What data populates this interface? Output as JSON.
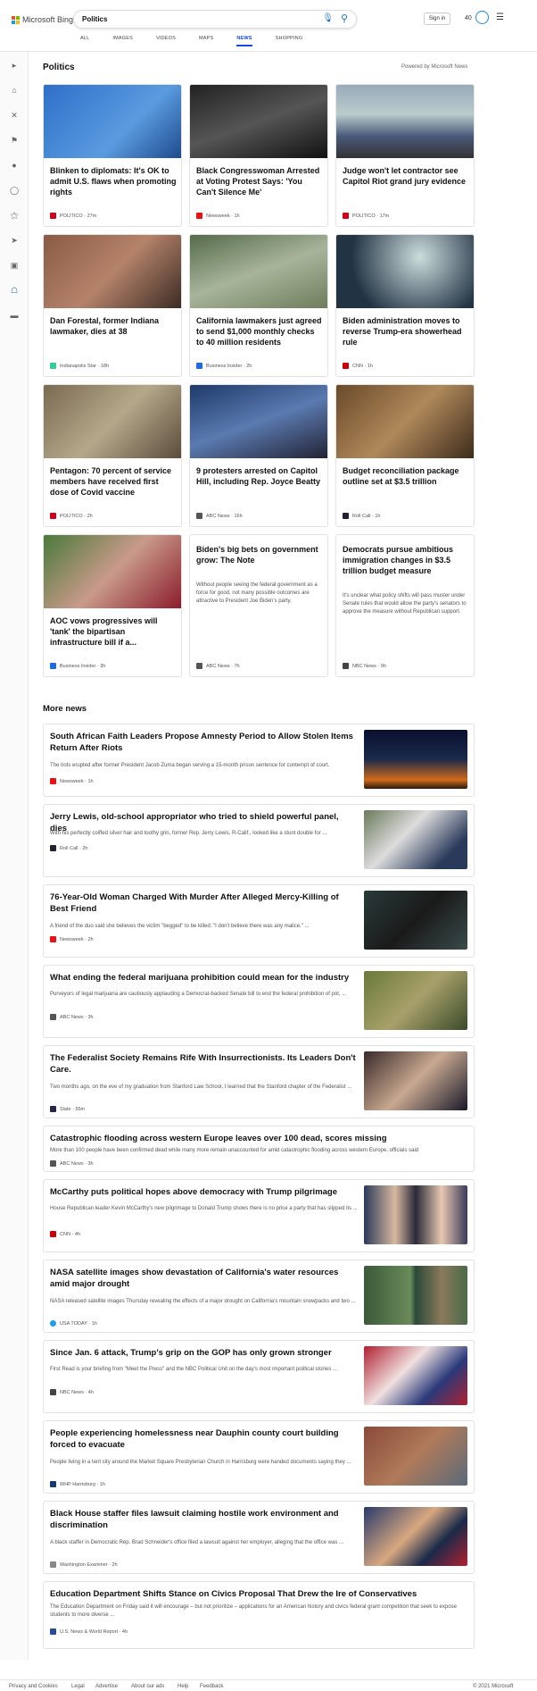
{
  "header": {
    "logo_text": "Microsoft Bing",
    "search_value": "Politics",
    "signin_label": "Sign in",
    "rewards_count": "40"
  },
  "tabs": [
    "ALL",
    "IMAGES",
    "VIDEOS",
    "MAPS",
    "NEWS",
    "SHOPPING"
  ],
  "main": {
    "title": "Politics",
    "powered_by": "Powered by Microsoft News"
  },
  "cards": [
    {
      "title": "Blinken to diplomats: It's OK to admit U.S. flaws when promoting rights",
      "source": "POLITICO",
      "age": "27m",
      "fav": "#d0021b"
    },
    {
      "title": "Black Congresswoman Arrested at Voting Protest Says: 'You Can't Silence Me'",
      "source": "Newsweek",
      "age": "1h",
      "fav": "#e11"
    },
    {
      "title": "Judge won't let contractor see Capitol Riot grand jury evidence",
      "source": "POLITICO",
      "age": "17m",
      "fav": "#d0021b"
    },
    {
      "title": "Dan Forestal, former Indiana lawmaker, dies at 38",
      "source": "Indianapolis Star",
      "age": "18h",
      "fav": "#3c9"
    },
    {
      "title": "California lawmakers just agreed to send $1,000 monthly checks to 40 million residents",
      "source": "Business Insider",
      "age": "2h",
      "fav": "#1d6ae5"
    },
    {
      "title": "Biden administration moves to reverse Trump-era showerhead rule",
      "source": "CNN",
      "age": "1h",
      "fav": "#c00"
    },
    {
      "title": "Pentagon: 70 percent of service members have received first dose of Covid vaccine",
      "source": "POLITICO",
      "age": "2h",
      "fav": "#d0021b"
    },
    {
      "title": "9 protesters arrested on Capitol Hill, including Rep. Joyce Beatty",
      "source": "ABC News",
      "age": "16h",
      "fav": "#555"
    },
    {
      "title": "Budget reconciliation package outline set at $3.5 trillion",
      "source": "Roll Call",
      "age": "1h",
      "fav": "#223"
    },
    {
      "title": "AOC vows progressives will 'tank' the bipartisan infrastructure bill if a...",
      "source": "Business Insider",
      "age": "3h",
      "fav": "#1d6ae5"
    },
    {
      "title": "Biden's big bets on government grow: The Note",
      "summary": "Without people seeing the federal government as a force for good, not many possible outcomes are attractive to President Joe Biden's party.",
      "source": "ABC News",
      "age": "7h",
      "fav": "#555"
    },
    {
      "title": "Democrats pursue ambitious immigration changes in $3.5 trillion budget measure",
      "summary": "It's unclear what policy shifts will pass muster under Senate rules that would allow the party's senators to approve the measure without Republican support.",
      "source": "NBC News",
      "age": "9h",
      "fav": "#444"
    }
  ],
  "more_news_title": "More news",
  "rows": [
    {
      "title": "South African Faith Leaders Propose Amnesty Period to Allow Stolen Items Return After Riots",
      "summary": "The riots erupted after former President Jacob Zuma began serving a 15-month prison sentence for contempt of court.",
      "source": "Newsweek",
      "age": "1h",
      "fav": "#e11"
    },
    {
      "title": "Jerry Lewis, old-school appropriator who tried to shield powerful panel, dies",
      "summary": "With his perfectly coiffed silver hair and toothy grin, former Rep. Jerry Lewis, R-Calif., looked like a stunt double for ...",
      "source": "Roll Call",
      "age": "2h",
      "fav": "#223"
    },
    {
      "title": "76-Year-Old Woman Charged With Murder After Alleged Mercy-Killing of Best Friend",
      "summary": "A friend of the duo said she believes the victim \"begged\" to be killed: \"I don't believe there was any malice.\" ...",
      "source": "Newsweek",
      "age": "2h",
      "fav": "#e11"
    },
    {
      "title": "What ending the federal marijuana prohibition could mean for the industry",
      "summary": "Purveyors of legal marijuana are cautiously applauding a Democrat-backed Senate bill to end the federal prohibition of pot, ...",
      "source": "ABC News",
      "age": "3h",
      "fav": "#555"
    },
    {
      "title": "The Federalist Society Remains Rife With Insurrectionists. Its Leaders Don't Care.",
      "summary": "Two months ago, on the eve of my graduation from Stanford Law School, I learned that the Stanford chapter of the Federalist ...",
      "source": "Slate",
      "age": "55m",
      "fav": "#26264d"
    },
    {
      "title": "Catastrophic flooding across western Europe leaves over 100 dead, scores missing",
      "summary": "More than 100 people have been confirmed dead while many more remain unaccounted for amid catastrophic flooding across western Europe, officials said",
      "source": "ABC News",
      "age": "3h",
      "fav": "#555"
    },
    {
      "title": "McCarthy puts political hopes above democracy with Trump pilgrimage",
      "summary": "House Republican leader Kevin McCarthy's new pilgrimage to Donald Trump shows there is no price a party that has slipped its ...",
      "source": "CNN",
      "age": "4h",
      "fav": "#c00"
    },
    {
      "title": "NASA satellite images show devastation of California's water resources amid major drought",
      "summary": "NASA released satellite images Thursday revealing the effects of a major drought on California's mountain snowpacks and two ...",
      "source": "USA TODAY",
      "age": "1h",
      "fav": "#1e9be9"
    },
    {
      "title": "Since Jan. 6 attack, Trump's grip on the GOP has only grown stronger",
      "summary": "First Read is your briefing from \"Meet the Press\" and the NBC Political Unit on the day's most important political stories ...",
      "source": "NBC News",
      "age": "4h",
      "fav": "#444"
    },
    {
      "title": "People experiencing homelessness near Dauphin county court building forced to evacuate",
      "summary": "People living in a tent city around the Market Square Presbyterian Church in Harrisburg were handed documents saying they ...",
      "source": "WHP Harrisburg",
      "age": "1h",
      "fav": "#123a7a"
    },
    {
      "title": "Black House staffer files lawsuit claiming hostile work environment and discrimination",
      "summary": "A black staffer in Democratic Rep. Brad Schneider's office filed a lawsuit against her employer, alleging that the office was ...",
      "source": "Washington Examiner",
      "age": "2h",
      "fav": "#888"
    },
    {
      "title": "Education Department Shifts Stance on Civics Proposal That Drew the Ire of Conservatives",
      "summary": "The Education Department on Friday said it will encourage – but not prioritize – applications for an American history and civics federal grant competition that seek to expose students to more diverse ...",
      "source": "U.S. News & World Report",
      "age": "4h",
      "fav": "#2a4a9a"
    }
  ],
  "footer": {
    "links": [
      "Privacy and Cookies",
      "Legal",
      "Advertise",
      "About our ads",
      "Help",
      "Feedback"
    ],
    "copyright": "© 2021 Microsoft"
  },
  "colors": {
    "accent": "#174ae4",
    "icon_blue": "#1a73c7"
  }
}
